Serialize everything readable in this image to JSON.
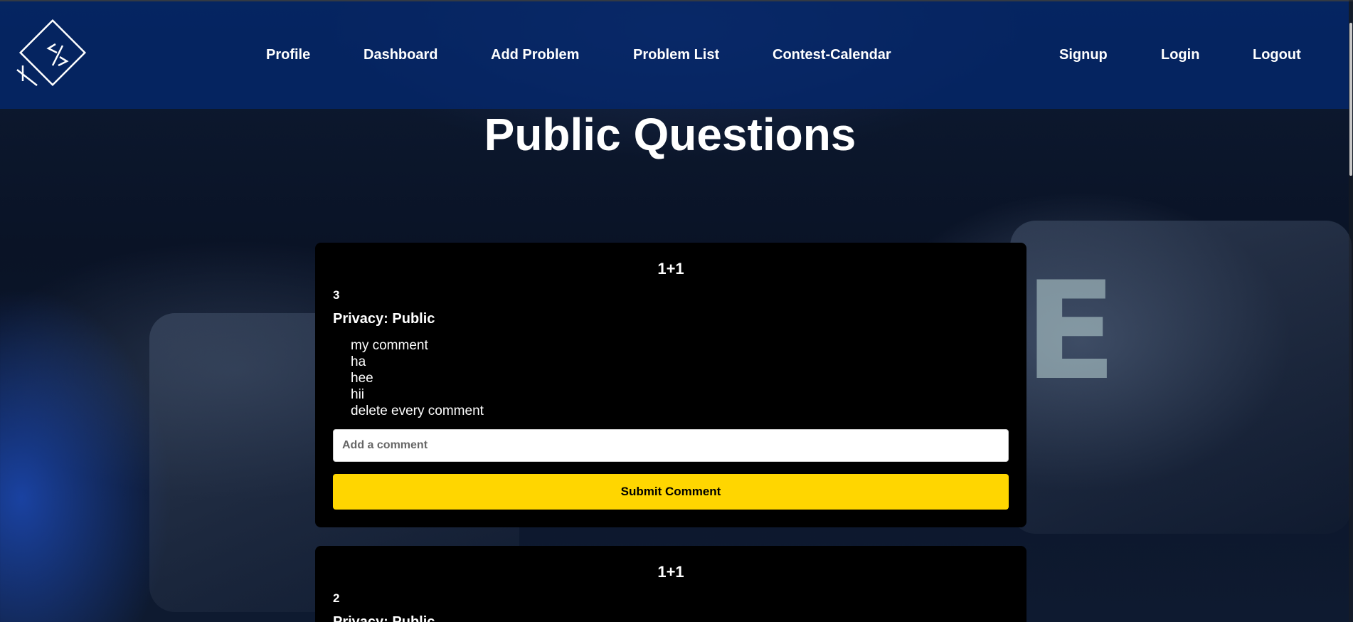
{
  "nav": {
    "logo_icon": "code-diamond-logo",
    "links": [
      {
        "label": "Profile"
      },
      {
        "label": "Dashboard"
      },
      {
        "label": "Add Problem"
      },
      {
        "label": "Problem List"
      },
      {
        "label": "Contest-Calendar"
      }
    ],
    "auth_links": [
      {
        "label": "Signup"
      },
      {
        "label": "Login"
      },
      {
        "label": "Logout"
      }
    ]
  },
  "page": {
    "title": "Public Questions"
  },
  "questions": [
    {
      "title": "1+1",
      "description": "3",
      "privacy_label": "Privacy:",
      "privacy_value": "Public",
      "comments": [
        "my comment",
        "ha",
        "hee",
        "hii",
        "delete every comment"
      ],
      "comment_placeholder": "Add a comment",
      "submit_label": "Submit Comment"
    },
    {
      "title": "1+1",
      "description": "2",
      "privacy_label": "Privacy:",
      "privacy_value": "Public"
    }
  ],
  "colors": {
    "navbar": "#04286e",
    "card": "#000000",
    "submit_button": "#ffd600",
    "text": "#ffffff"
  }
}
